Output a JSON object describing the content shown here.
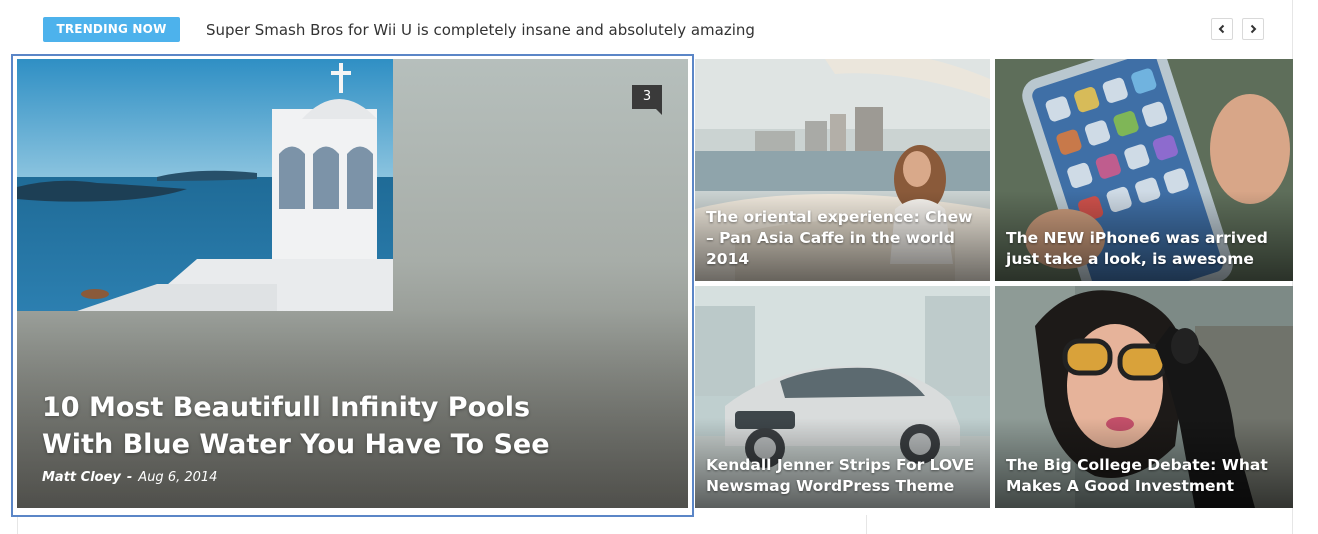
{
  "trending": {
    "badge_label": "TRENDING NOW",
    "headline": "Super Smash Bros for Wii U is completely insane and absolutely amazing"
  },
  "nav": {
    "prev_icon": "chevron-left-icon",
    "next_icon": "chevron-right-icon"
  },
  "feature": {
    "comment_count": "3",
    "title": "10 Most Beautifull Infinity Pools With Blue Water You Have To See",
    "author": "Matt Cloey",
    "separator": "-",
    "date": "Aug 6, 2014"
  },
  "tiles": [
    {
      "title": "The oriental experience: Chew – Pan Asia Caffe in the world 2014"
    },
    {
      "title": "The NEW iPhone6 was arrived just take a look, is awesome"
    },
    {
      "title": "Kendall Jenner Strips For LOVE Newsmag WordPress Theme"
    },
    {
      "title": "The Big College Debate: What Makes A Good Investment"
    }
  ]
}
